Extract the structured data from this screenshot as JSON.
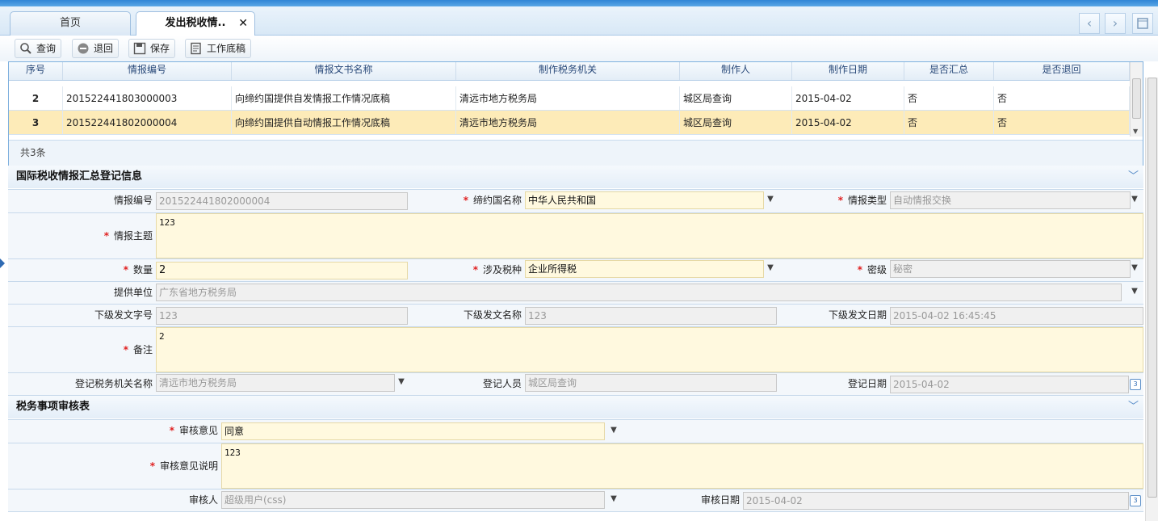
{
  "tabs": {
    "home": "首页",
    "active": "发出税收情..",
    "close": "✕"
  },
  "nav": {
    "prev": "‹",
    "next": "›"
  },
  "toolbar": {
    "query": "查询",
    "return": "退回",
    "save": "保存",
    "draft": "工作底稿"
  },
  "grid": {
    "headers": [
      "序号",
      "情报编号",
      "情报文书名称",
      "制作税务机关",
      "制作人",
      "制作日期",
      "是否汇总",
      "是否退回"
    ],
    "rows": [
      [
        "2",
        "201522441803000003",
        "向缔约国提供自发情报工作情况底稿",
        "清远市地方税务局",
        "城区局查询",
        "2015-04-02",
        "否",
        "否"
      ],
      [
        "3",
        "201522441802000004",
        "向缔约国提供自动情报工作情况底稿",
        "清远市地方税务局",
        "城区局查询",
        "2015-04-02",
        "否",
        "否"
      ]
    ],
    "total": "共3条"
  },
  "section1": {
    "title": "国际税收情报汇总登记信息",
    "intel_no_label": "情报编号",
    "intel_no": "201522441802000004",
    "country_label": "缔约国名称",
    "country": "中华人民共和国",
    "type_label": "情报类型",
    "type": "自动情报交换",
    "subject_label": "情报主题",
    "subject": "123",
    "qty_label": "数量",
    "qty": "2",
    "tax_label": "涉及税种",
    "tax": "企业所得税",
    "secret_label": "密级",
    "secret": "秘密",
    "provider_label": "提供单位",
    "provider": "广东省地方税务局",
    "doc_no_label": "下级发文字号",
    "doc_no": "123",
    "doc_name_label": "下级发文名称",
    "doc_name": "123",
    "doc_date_label": "下级发文日期",
    "doc_date": "2015-04-02 16:45:45",
    "remark_label": "备注",
    "remark": "2",
    "reg_org_label": "登记税务机关名称",
    "reg_org": "清远市地方税务局",
    "reg_person_label": "登记人员",
    "reg_person": "城区局查询",
    "reg_date_label": "登记日期",
    "reg_date": "2015-04-02"
  },
  "section2": {
    "title": "税务事项审核表",
    "opinion_label": "审核意见",
    "opinion": "同意",
    "opinion_desc_label": "审核意见说明",
    "opinion_desc": "123",
    "reviewer_label": "审核人",
    "reviewer": "超级用户(css)",
    "review_date_label": "审核日期",
    "review_date": "2015-04-02"
  }
}
